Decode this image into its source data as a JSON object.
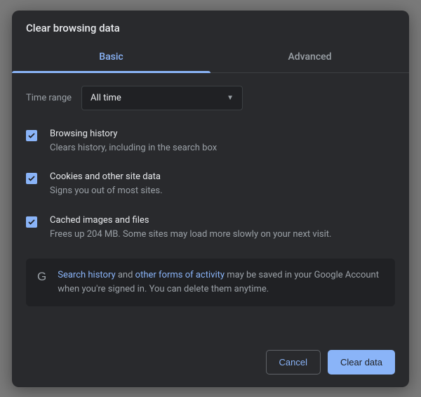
{
  "dialog": {
    "title": "Clear browsing data",
    "tabs": {
      "basic": "Basic",
      "advanced": "Advanced"
    },
    "time_range": {
      "label": "Time range",
      "selected": "All time"
    },
    "options": [
      {
        "title": "Browsing history",
        "desc": "Clears history, including in the search box",
        "checked": true
      },
      {
        "title": "Cookies and other site data",
        "desc": "Signs you out of most sites.",
        "checked": true
      },
      {
        "title": "Cached images and files",
        "desc": "Frees up 204 MB. Some sites may load more slowly on your next visit.",
        "checked": true
      }
    ],
    "info": {
      "link1": "Search history",
      "mid1": " and ",
      "link2": "other forms of activity",
      "rest": " may be saved in your Google Account when you're signed in. You can delete them anytime."
    },
    "buttons": {
      "cancel": "Cancel",
      "confirm": "Clear data"
    }
  }
}
